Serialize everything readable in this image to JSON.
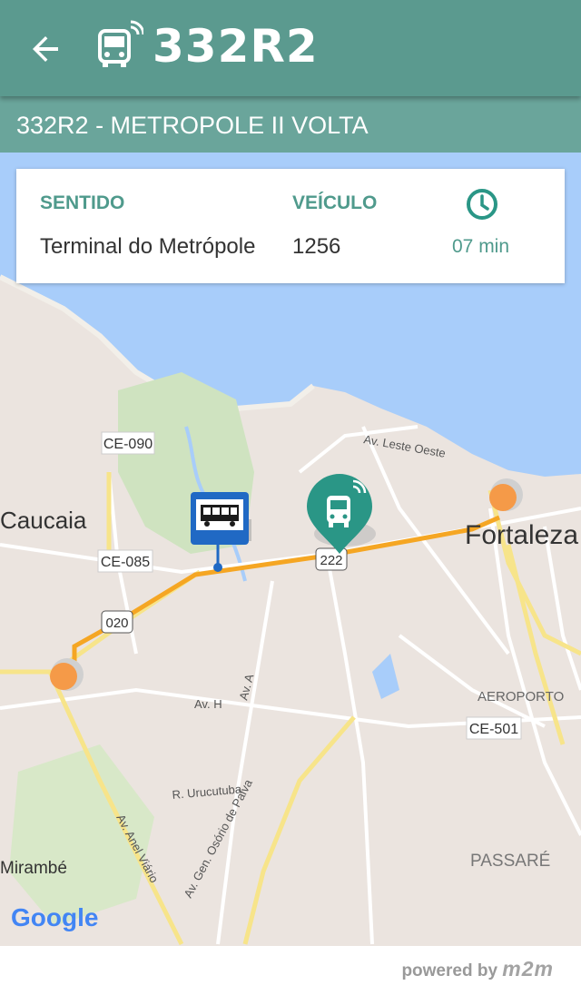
{
  "header": {
    "title": "332R2",
    "back_icon": "arrow-back-icon",
    "bus_icon": "bus-signal-icon"
  },
  "route": {
    "subtitle": "332R2 - METROPOLE II VOLTA"
  },
  "info_card": {
    "sentido_label": "SENTIDO",
    "sentido_value": "Terminal do Metrópole",
    "veiculo_label": "VEÍCULO",
    "veiculo_value": "1256",
    "eta": "07 min",
    "clock_icon": "clock-icon"
  },
  "map": {
    "labels": {
      "ce090": "CE-090",
      "caucaia": "Caucaia",
      "ce085": "CE-085",
      "r020": "020",
      "r222": "222",
      "fortaleza": "Fortaleza",
      "av_leste_oeste": "Av. Leste Oeste",
      "aeroporto": "AEROPORTO",
      "ce501": "CE-501",
      "av_h": "Av. H",
      "av_a": "Av. A",
      "r_urucutuba": "R. Urucutuba",
      "av_anel_viario": "Av. Anel Viário",
      "av_gen": "Av. Gen. Osório de Paiva",
      "passare": "PASSARÉ",
      "mirambe": "Mirambé",
      "google": "Google"
    },
    "colors": {
      "route": "#f5a623",
      "water": "#a8cdfa",
      "land": "#ebe4df",
      "stop": "#f59a48"
    }
  },
  "footer": {
    "powered_by": "powered by",
    "brand": "m2m"
  }
}
